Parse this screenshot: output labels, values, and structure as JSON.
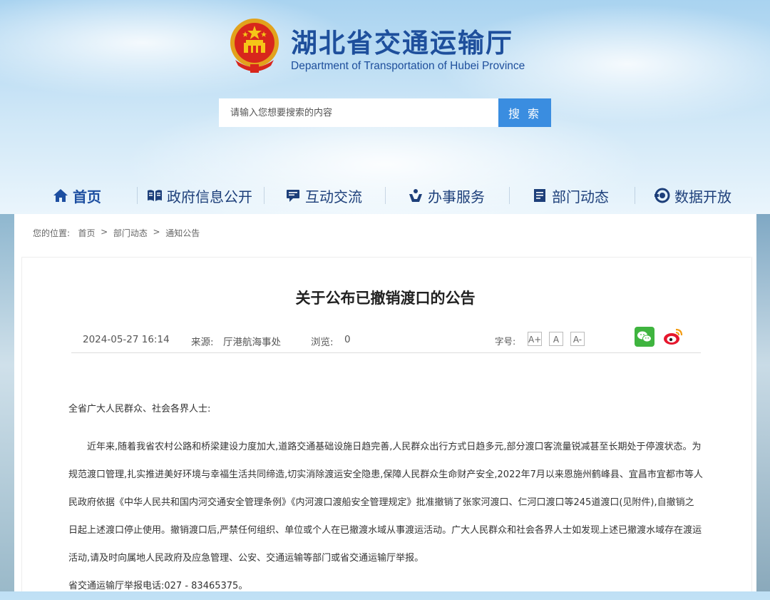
{
  "header": {
    "title": "湖北省交通运输厅",
    "subtitle": "Department of Transportation of Hubei Province"
  },
  "search": {
    "placeholder": "请输入您想要搜索的内容",
    "button_label": "搜 索"
  },
  "nav": {
    "items": [
      {
        "label": "首页",
        "icon": "home-icon"
      },
      {
        "label": "政府信息公开",
        "icon": "book-icon"
      },
      {
        "label": "互动交流",
        "icon": "chat-icon"
      },
      {
        "label": "办事服务",
        "icon": "service-icon"
      },
      {
        "label": "部门动态",
        "icon": "document-icon"
      },
      {
        "label": "数据开放",
        "icon": "data-icon"
      }
    ]
  },
  "breadcrumb": {
    "prefix": "您的位置:",
    "items": [
      "首页",
      "部门动态",
      "通知公告"
    ],
    "separator": ">"
  },
  "article": {
    "title": "关于公布已撤销渡口的公告",
    "date": "2024-05-27 16:14",
    "source_label": "来源:",
    "source": "厅港航海事处",
    "views_label": "浏览:",
    "views": "0",
    "font_size_label": "字号:",
    "font_buttons": [
      "A+",
      "A",
      "A-"
    ],
    "salutation": "全省广大人民群众、社会各界人士:",
    "paragraph": "近年来,随着我省农村公路和桥梁建设力度加大,道路交通基础设施日趋完善,人民群众出行方式日趋多元,部分渡口客流量锐减甚至长期处于停渡状态。为规范渡口管理,扎实推进美好环境与幸福生活共同缔造,切实消除渡运安全隐患,保障人民群众生命财产安全,2022年7月以来恩施州鹤峰县、宜昌市宜都市等人民政府依据《中华人民共和国内河交通安全管理条例》《内河渡口渡船安全管理规定》批准撤销了张家河渡口、仁河口渡口等245道渡口(见附件),自撤销之日起上述渡口停止使用。撤销渡口后,严禁任何组织、单位或个人在已撤渡水域从事渡运活动。广大人民群众和社会各界人士如发现上述已撤渡水域存在渡运活动,请及时向属地人民政府及应急管理、公安、交通运输等部门或省交通运输厅举报。",
    "hotline": "省交通运输厅举报电话:027 - 83465375。"
  },
  "colors": {
    "brand_blue": "#1e4f9c",
    "search_button": "#3a8de0",
    "wechat_green": "#3fb43f",
    "weibo_red": "#e6162d"
  }
}
